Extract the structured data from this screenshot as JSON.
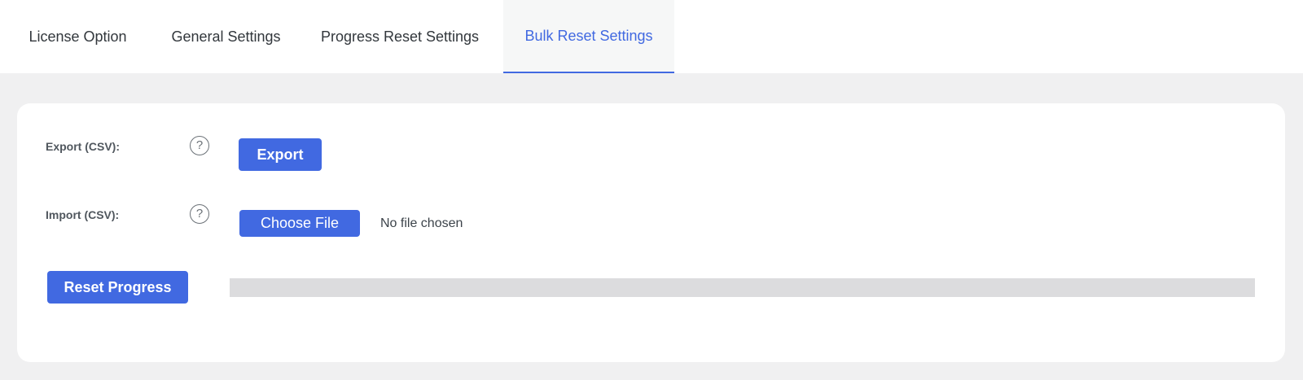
{
  "tabs": [
    {
      "label": "License Option",
      "active": false
    },
    {
      "label": "General Settings",
      "active": false
    },
    {
      "label": "Progress Reset Settings",
      "active": false
    },
    {
      "label": "Bulk Reset Settings",
      "active": true
    }
  ],
  "export": {
    "label": "Export (CSV):",
    "help_icon": "question-circle-icon",
    "help_glyph": "?",
    "button_label": "Export"
  },
  "import": {
    "label": "Import (CSV):",
    "help_icon": "question-circle-icon",
    "help_glyph": "?",
    "button_label": "Choose File",
    "file_status": "No file chosen"
  },
  "reset": {
    "button_label": "Reset Progress",
    "progress": 0
  },
  "colors": {
    "accent": "#4169e1",
    "page_background": "#f0f0f1",
    "progress_track": "#dcdcde"
  }
}
